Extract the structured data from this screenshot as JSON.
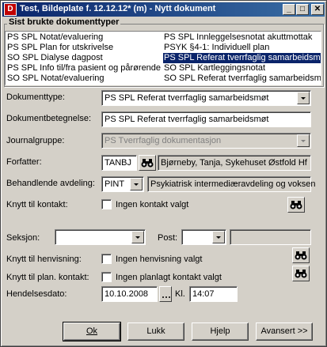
{
  "window": {
    "title": "Test, Bildeplate f. 12.12.12* (m) - Nytt dokument",
    "app_icon_glyph": "D",
    "controls": {
      "minimize": "_",
      "maximize": "□",
      "close": "✕"
    }
  },
  "recent": {
    "title": "Sist brukte dokumenttyper",
    "items_left": [
      "PS SPL Notat/evaluering",
      "PS SPL Plan for utskrivelse",
      "SO SPL Dialyse dagpost",
      "PS SPL Info til/fra pasient og pårørende",
      "SO SPL Notat/evaluering"
    ],
    "items_right": [
      "PS SPL Innleggelsesnotat akuttmottak",
      "PSYK §4-1: Individuell plan",
      "PS SPL Referat tverrfaglig samarbeidsmøt",
      "SO SPL Kartleggingsnotat",
      "SO SPL Referat tverrfaglig samarbeidsmøt"
    ],
    "selected_right_index": 2
  },
  "form": {
    "dokumenttype": {
      "label": "Dokumenttype:",
      "value": "PS SPL Referat tverrfaglig samarbeidsmøt"
    },
    "dokumentbetegnelse": {
      "label": "Dokumentbetegnelse:",
      "value": "PS SPL Referat tverrfaglig samarbeidsmøt"
    },
    "journalgruppe": {
      "label": "Journalgruppe:",
      "value": "PS Tverrfaglig dokumentasjon"
    },
    "forfatter": {
      "label": "Forfatter:",
      "code": "TANBJ",
      "name": "Bjørneby, Tanja, Sykehuset Østfold Hf"
    },
    "avdeling": {
      "label": "Behandlende avdeling:",
      "code": "PINT",
      "name": "Psykiatrisk intermediæravdeling og voksen"
    },
    "kontakt": {
      "label": "Knytt til kontakt:",
      "checkbox_label": "Ingen kontakt valgt"
    },
    "seksjon": {
      "label": "Seksjon:",
      "value": ""
    },
    "post": {
      "label": "Post:",
      "value": "",
      "name": ""
    },
    "henvisning": {
      "label": "Knytt til henvisning:",
      "checkbox_label": "Ingen henvisning valgt"
    },
    "plan_kontakt": {
      "label": "Knytt til plan. kontakt:",
      "checkbox_label": "Ingen planlagt kontakt valgt"
    },
    "hendelsesdato": {
      "label": "Hendelsesdato:",
      "date": "10.10.2008",
      "time_label": "Kl.",
      "time": "14:07"
    }
  },
  "buttons": {
    "ok": "Ok",
    "lukk": "Lukk",
    "hjelp": "Hjelp",
    "avansert": "Avansert >>"
  }
}
